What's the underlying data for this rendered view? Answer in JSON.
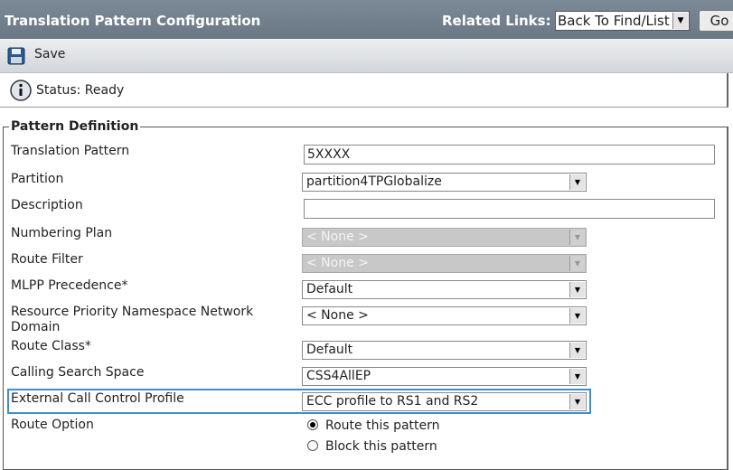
{
  "header": {
    "title": "Translation Pattern Configuration",
    "related_links_label": "Related Links:",
    "related_links_value": "Back To Find/List",
    "go_label": "Go"
  },
  "toolbar": {
    "save_label": "Save"
  },
  "status": {
    "text": "Status: Ready"
  },
  "section": {
    "legend": "Pattern Definition"
  },
  "fields": {
    "translation_pattern": {
      "label": "Translation Pattern",
      "value": "5XXXX"
    },
    "partition": {
      "label": "Partition",
      "value": "partition4TPGlobalize"
    },
    "description": {
      "label": "Description",
      "value": ""
    },
    "numbering_plan": {
      "label": "Numbering Plan",
      "value": "< None >"
    },
    "route_filter": {
      "label": "Route Filter",
      "value": "< None >"
    },
    "mlpp_precedence": {
      "label": "MLPP Precedence*",
      "value": "Default"
    },
    "resource_priority": {
      "label_line1": "Resource Priority Namespace Network",
      "label_line2": "Domain",
      "value": "< None >"
    },
    "route_class": {
      "label": "Route Class*",
      "value": "Default"
    },
    "calling_search_space": {
      "label": "Calling Search Space",
      "value": "CSS4AllEP"
    },
    "external_call_control": {
      "label": "External Call Control Profile",
      "value": "ECC profile to RS1 and RS2"
    },
    "route_option": {
      "label": "Route Option",
      "options": [
        "Route this pattern",
        "Block this pattern"
      ],
      "selected": "Route this pattern"
    }
  },
  "colors": {
    "header_bg": "#6f7d8b",
    "highlight_border": "#3e8ed0"
  }
}
